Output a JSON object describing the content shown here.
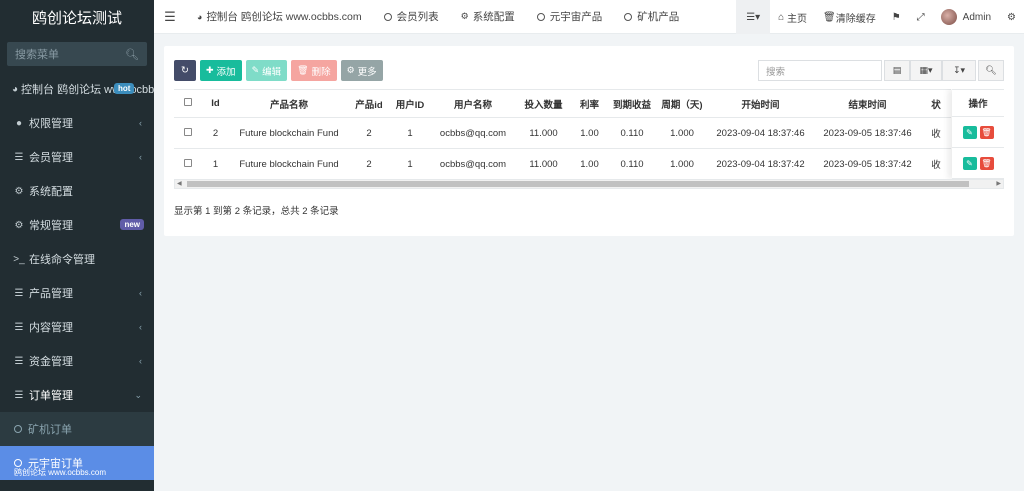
{
  "sidebar": {
    "logo": "鸥创论坛测试",
    "search_placeholder": "搜索菜单",
    "items": [
      {
        "label": "控制台 鸥创论坛 www.ocbbs.com",
        "badge": "hot",
        "icon": "dashboard-icon"
      },
      {
        "label": "权限管理",
        "icon": "users-icon"
      },
      {
        "label": "会员管理",
        "icon": "list-icon"
      },
      {
        "label": "系统配置",
        "icon": "gear-icon"
      },
      {
        "label": "常规管理",
        "badge": "new",
        "icon": "gears-icon"
      },
      {
        "label": "在线命令管理",
        "icon": "terminal-icon"
      },
      {
        "label": "产品管理",
        "icon": "list-icon"
      },
      {
        "label": "内容管理",
        "icon": "list-icon"
      },
      {
        "label": "资金管理",
        "icon": "list-icon"
      },
      {
        "label": "订单管理",
        "icon": "list-icon"
      }
    ],
    "sub_items": [
      "矿机订单",
      "元宇宙订单"
    ],
    "watermark": "鸥创论坛 www.ocbbs.com"
  },
  "topnav": {
    "tabs": [
      {
        "label": "控制台 鸥创论坛 www.ocbbs.com",
        "icon": "dashboard-icon"
      },
      {
        "label": "会员列表",
        "icon": "circle-icon"
      },
      {
        "label": "系统配置",
        "icon": "gear-icon"
      },
      {
        "label": "元宇宙产品",
        "icon": "circle-icon"
      },
      {
        "label": "矿机产品",
        "icon": "circle-icon"
      }
    ],
    "home": "主页",
    "clear_cache": "清除缓存",
    "user": "Admin"
  },
  "toolbar": {
    "add": "添加",
    "edit": "编辑",
    "delete": "删除",
    "more": "更多",
    "search_placeholder": "搜索"
  },
  "table": {
    "columns": [
      "Id",
      "产品名称",
      "产品id",
      "用户ID",
      "用户名称",
      "投入数量",
      "利率",
      "到期收益",
      "周期（天)",
      "开始时间",
      "结束时间",
      "状",
      "操作"
    ],
    "rows": [
      [
        "2",
        "Future blockchain Fund",
        "2",
        "1",
        "ocbbs@qq.com",
        "11.000",
        "1.00",
        "0.110",
        "1.000",
        "2023-09-04 18:37:46",
        "2023-09-05 18:37:46",
        "收"
      ],
      [
        "1",
        "Future blockchain Fund",
        "2",
        "1",
        "ocbbs@qq.com",
        "11.000",
        "1.00",
        "0.110",
        "1.000",
        "2023-09-04 18:37:42",
        "2023-09-05 18:37:42",
        "收"
      ]
    ]
  },
  "summary": "显示第 1 到第 2 条记录，总共 2 条记录"
}
